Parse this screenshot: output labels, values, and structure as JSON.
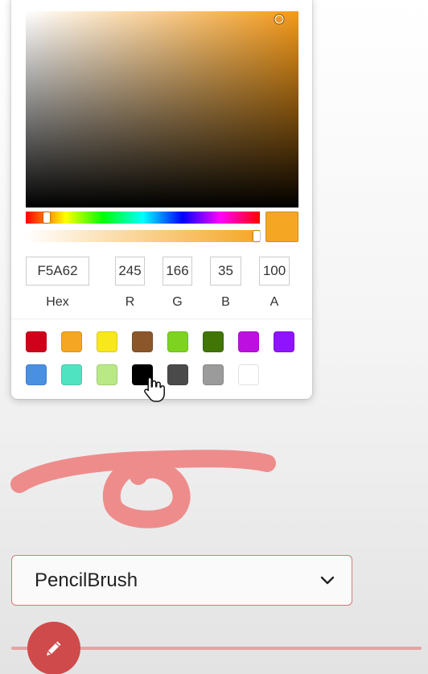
{
  "color_picker": {
    "current_color": "#F5A623",
    "hue_color": "#F59A18",
    "saturation_pct": 93,
    "brightness_pct": 96,
    "hue_pct": 9,
    "alpha_pct": 100,
    "fields": {
      "hex": {
        "value": "F5A62",
        "label": "Hex"
      },
      "r": {
        "value": "245",
        "label": "R"
      },
      "g": {
        "value": "166",
        "label": "G"
      },
      "b": {
        "value": "35",
        "label": "B"
      },
      "a": {
        "value": "100",
        "label": "A"
      }
    },
    "preset_swatches": [
      [
        "#D0021B",
        "#F5A623",
        "#F8E71C",
        "#8B572A",
        "#7ED321",
        "#417505",
        "#BD10E0",
        "#9013FE"
      ],
      [
        "#4A90E2",
        "#50E3C2",
        "#B8E986",
        "#000000",
        "#4A4A4A",
        "#9B9B9B",
        "#FFFFFF"
      ]
    ]
  },
  "canvas": {
    "stroke_color": "#EE8C8C"
  },
  "brush": {
    "selected": "PencilBrush",
    "accent_color": "#D47A7A"
  },
  "width_slider": {
    "value_pct": 12,
    "icon": "pencil-icon",
    "knob_color": "#CF4A4A"
  }
}
